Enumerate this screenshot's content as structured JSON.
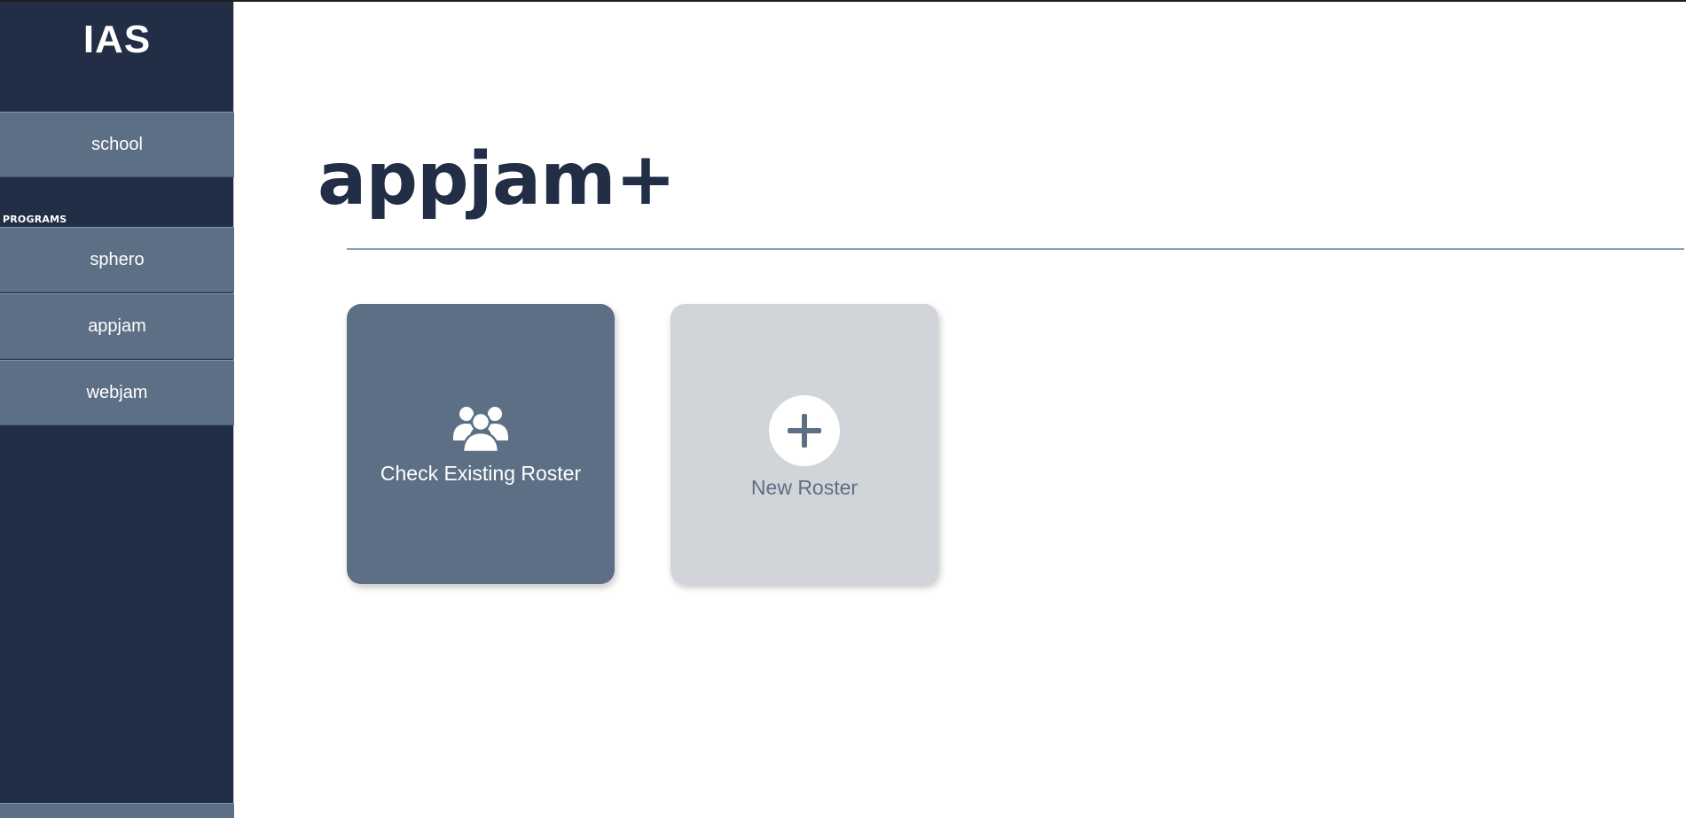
{
  "sidebar": {
    "brand": "IAS",
    "school_label": "school",
    "section_label": "PROGRAMS",
    "programs": [
      {
        "label": "sphero"
      },
      {
        "label": "appjam"
      },
      {
        "label": "webjam"
      }
    ]
  },
  "main": {
    "title": "appjam+",
    "cards": [
      {
        "label": "Check Existing Roster",
        "icon": "users-group-icon"
      },
      {
        "label": "New Roster",
        "icon": "plus-icon"
      }
    ]
  },
  "colors": {
    "sidebar_bg": "#222e46",
    "nav_item_bg": "#5c6f84",
    "title_color": "#222e46",
    "card_primary": "#5c6f84",
    "card_secondary": "#d1d5da"
  }
}
